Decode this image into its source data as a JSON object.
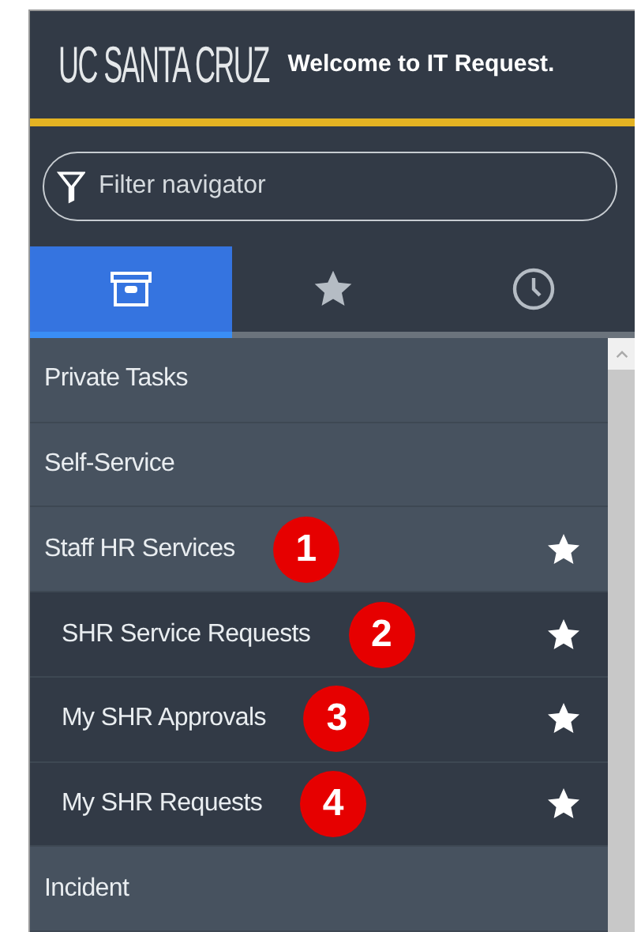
{
  "header": {
    "logo": "UC SANTA CRUZ",
    "welcome": "Welcome to IT Request."
  },
  "filter": {
    "placeholder": "Filter navigator"
  },
  "tabs": [
    {
      "kind": "archive",
      "selected": true
    },
    {
      "kind": "star",
      "selected": false
    },
    {
      "kind": "clock",
      "selected": false
    }
  ],
  "nav": [
    {
      "label": "Private Tasks",
      "favorite": false
    },
    {
      "label": "Self-Service",
      "favorite": false
    },
    {
      "label": "Staff HR Services",
      "favorite": true,
      "badge": "1",
      "children": [
        {
          "label": "SHR Service Requests",
          "favorite": true,
          "badge": "2"
        },
        {
          "label": "My SHR Approvals",
          "favorite": true,
          "badge": "3"
        },
        {
          "label": "My SHR Requests",
          "favorite": true,
          "badge": "4"
        }
      ]
    },
    {
      "label": "Incident",
      "favorite": false
    }
  ]
}
